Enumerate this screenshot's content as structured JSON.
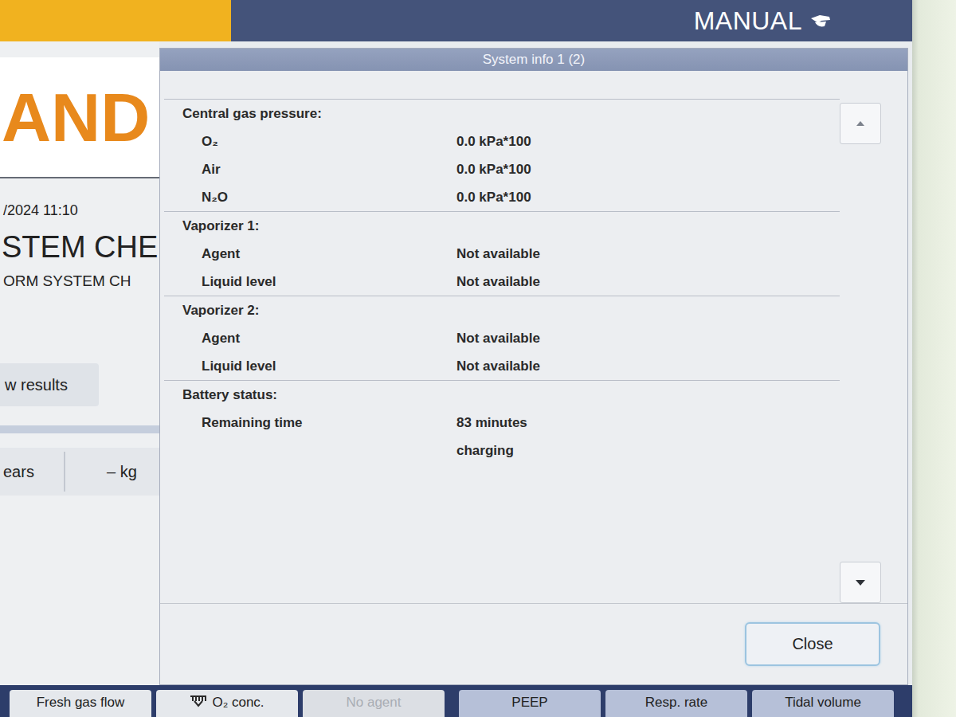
{
  "header": {
    "mode": "MANUAL"
  },
  "background": {
    "brand": "AND",
    "datetime": "/2024 11:10",
    "title": "STEM CHE",
    "subtitle": "ORM SYSTEM CH",
    "results_button": "w results",
    "age_unit": "ears",
    "weight": "– kg"
  },
  "dialog": {
    "title": "System info 1 (2)",
    "sections": [
      {
        "title": "Central gas pressure:",
        "rows": [
          {
            "label": "O₂",
            "value": "0.0 kPa*100"
          },
          {
            "label": "Air",
            "value": "0.0 kPa*100"
          },
          {
            "label": "N₂O",
            "value": "0.0 kPa*100"
          }
        ]
      },
      {
        "title": "Vaporizer 1:",
        "rows": [
          {
            "label": "Agent",
            "value": "Not available"
          },
          {
            "label": "Liquid level",
            "value": "Not available"
          }
        ]
      },
      {
        "title": "Vaporizer 2:",
        "rows": [
          {
            "label": "Agent",
            "value": "Not available"
          },
          {
            "label": "Liquid level",
            "value": "Not available"
          }
        ]
      },
      {
        "title": "Battery status:",
        "rows": [
          {
            "label": "Remaining time",
            "value": "83 minutes"
          },
          {
            "label": "",
            "value": "charging"
          }
        ]
      }
    ],
    "buttons": [
      "Close"
    ]
  },
  "bottom_bar": [
    {
      "label": "Fresh gas flow",
      "kind": "gas",
      "disabled": false
    },
    {
      "label": "O₂ conc.",
      "kind": "gas-icon",
      "disabled": false
    },
    {
      "label": "No agent",
      "kind": "gas",
      "disabled": true
    },
    {
      "label": "PEEP",
      "kind": "ventilation",
      "disabled": false
    },
    {
      "label": "Resp. rate",
      "kind": "ventilation",
      "disabled": false
    },
    {
      "label": "Tidal volume",
      "kind": "ventilation",
      "disabled": false
    }
  ]
}
